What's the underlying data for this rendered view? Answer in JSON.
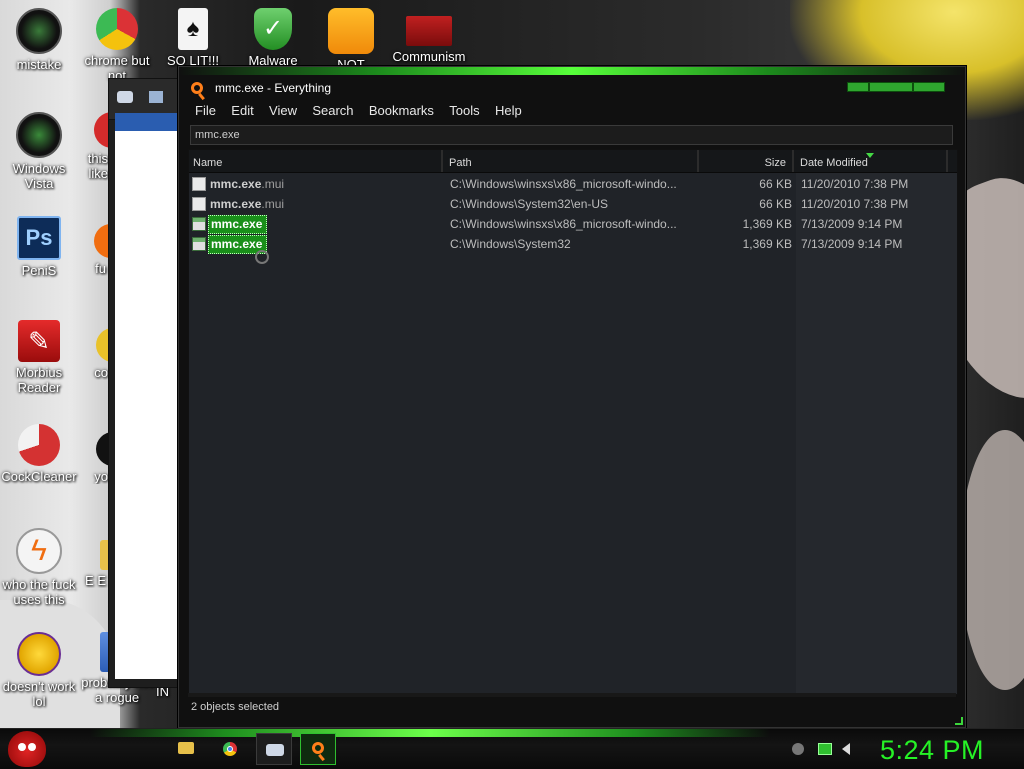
{
  "desktop": {
    "icons": [
      {
        "label": "mistake",
        "icon": "green-circle-icon"
      },
      {
        "label": "chrome but not",
        "icon": "chrome-icon"
      },
      {
        "label": "SO LIT!!!",
        "icon": "playing-card-icon"
      },
      {
        "label": "Malware",
        "icon": "shield-check-icon"
      },
      {
        "label": "NOT",
        "icon": "green-pig-icon"
      },
      {
        "label": "Communism",
        "icon": "red-emblem-icon"
      },
      {
        "label": "Windows Vista",
        "icon": "recycle-bin-icon"
      },
      {
        "label": "this like",
        "icon": "red-orb-icon"
      },
      {
        "label": "PeniS",
        "icon": "photoshop-icon"
      },
      {
        "label": "fu",
        "icon": "orange-icon"
      },
      {
        "label": "Morbius Reader",
        "icon": "acrobat-icon"
      },
      {
        "label": "co",
        "icon": "yellow-icon"
      },
      {
        "label": "CockCleaner",
        "icon": "ccleaner-icon"
      },
      {
        "label": "yo",
        "icon": "black-icon"
      },
      {
        "label": "who the fuck uses this",
        "icon": "lightning-icon"
      },
      {
        "label": "E E",
        "icon": "folder-icon"
      },
      {
        "label": "doesn't work lol",
        "icon": "yahoo-messenger-icon"
      },
      {
        "label": "probably not a rogue",
        "icon": "blue-doc-icon"
      },
      {
        "label": "IN",
        "icon": "generic-icon"
      }
    ]
  },
  "window": {
    "title": "mmc.exe - Everything",
    "menu": [
      "File",
      "Edit",
      "View",
      "Search",
      "Bookmarks",
      "Tools",
      "Help"
    ],
    "search_value": "mmc.exe",
    "columns": {
      "name": "Name",
      "path": "Path",
      "size": "Size",
      "date": "Date Modified"
    },
    "rows": [
      {
        "name_bold": "mmc.exe",
        "name_ext": ".mui",
        "path": "C:\\Windows\\winsxs\\x86_microsoft-windo...",
        "size": "66 KB",
        "date": "11/20/2010 7:38 PM",
        "icon": "document-icon",
        "selected": false
      },
      {
        "name_bold": "mmc.exe",
        "name_ext": ".mui",
        "path": "C:\\Windows\\System32\\en-US",
        "size": "66 KB",
        "date": "11/20/2010 7:38 PM",
        "icon": "document-icon",
        "selected": false
      },
      {
        "name_bold": "mmc.exe",
        "name_ext": "",
        "path": "C:\\Windows\\winsxs\\x86_microsoft-windo...",
        "size": "1,369 KB",
        "date": "7/13/2009 9:14 PM",
        "icon": "executable-icon",
        "selected": true
      },
      {
        "name_bold": "mmc.exe",
        "name_ext": "",
        "path": "C:\\Windows\\System32",
        "size": "1,369 KB",
        "date": "7/13/2009 9:14 PM",
        "icon": "executable-icon",
        "selected": true
      }
    ],
    "status": "2 objects selected"
  },
  "taskbar": {
    "clock": "5:24 PM",
    "accent_color": "#26f226"
  },
  "colors": {
    "selection": "#1a8f1a",
    "search_icon": "#ff7f1a"
  }
}
